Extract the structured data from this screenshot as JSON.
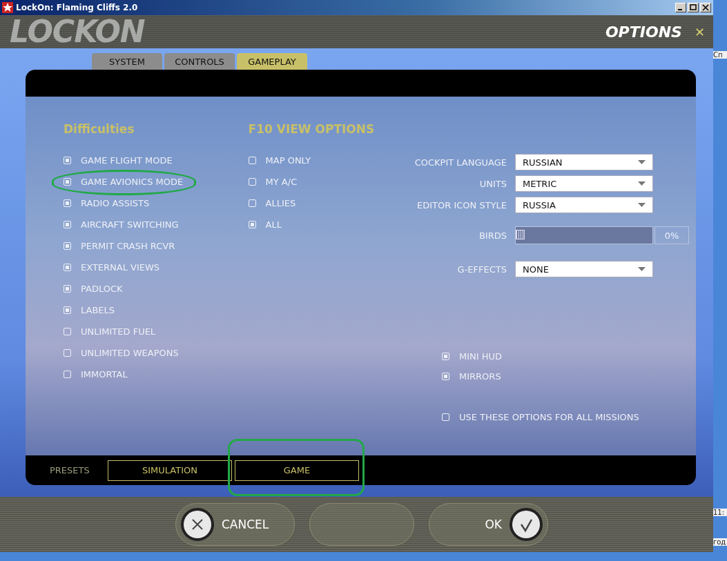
{
  "window": {
    "title": "LockOn: Flaming Cliffs 2.0"
  },
  "header": {
    "logo": "LOCKON",
    "title": "OPTIONS",
    "close": "✕"
  },
  "tabs": [
    {
      "label": "SYSTEM",
      "selected": false
    },
    {
      "label": "CONTROLS",
      "selected": false
    },
    {
      "label": "GAMEPLAY",
      "selected": true
    }
  ],
  "difficulties": {
    "title": "Difficulties",
    "items": [
      {
        "label": "GAME FLIGHT MODE",
        "checked": true
      },
      {
        "label": "GAME AVIONICS MODE",
        "checked": true
      },
      {
        "label": "RADIO ASSISTS",
        "checked": true
      },
      {
        "label": "AIRCRAFT SWITCHING",
        "checked": true
      },
      {
        "label": "PERMIT CRASH RCVR",
        "checked": true
      },
      {
        "label": "EXTERNAL VIEWS",
        "checked": true
      },
      {
        "label": "PADLOCK",
        "checked": true
      },
      {
        "label": "LABELS",
        "checked": true
      },
      {
        "label": "UNLIMITED FUEL",
        "checked": false
      },
      {
        "label": "UNLIMITED WEAPONS",
        "checked": false
      },
      {
        "label": "IMMORTAL",
        "checked": false
      }
    ]
  },
  "f10_view_options": {
    "title": "F10 VIEW OPTIONS",
    "items": [
      {
        "label": "MAP ONLY",
        "checked": false
      },
      {
        "label": "MY A/C",
        "checked": false
      },
      {
        "label": "ALLIES",
        "checked": false
      },
      {
        "label": "ALL",
        "checked": true
      }
    ]
  },
  "settings": [
    {
      "kind": "select",
      "label": "COCKPIT LANGUAGE",
      "value": "RUSSIAN"
    },
    {
      "kind": "select",
      "label": "UNITS",
      "value": "METRIC"
    },
    {
      "kind": "select",
      "label": "EDITOR ICON STYLE",
      "value": "RUSSIA"
    },
    {
      "kind": "slider",
      "label": "BIRDS",
      "level": 0,
      "reading": "0%"
    },
    {
      "kind": "select",
      "label": "G-EFFECTS",
      "value": "NONE"
    }
  ],
  "view_options": [
    {
      "label": "MINI HUD",
      "checked": true
    },
    {
      "label": "MIRRORS",
      "checked": true
    }
  ],
  "all_missions": {
    "label": "USE THESE OPTIONS FOR ALL MISSIONS",
    "checked": false
  },
  "presets": {
    "label": "PRESETS",
    "buttons": [
      "SIMULATION",
      "GAME"
    ]
  },
  "footer_buttons": [
    {
      "kind": "cancel",
      "label": "CANCEL"
    },
    {
      "kind": "blank"
    },
    {
      "kind": "ok",
      "label": "OK"
    }
  ],
  "desktop_fragments": [
    "Сп",
    "11:",
    "год"
  ]
}
